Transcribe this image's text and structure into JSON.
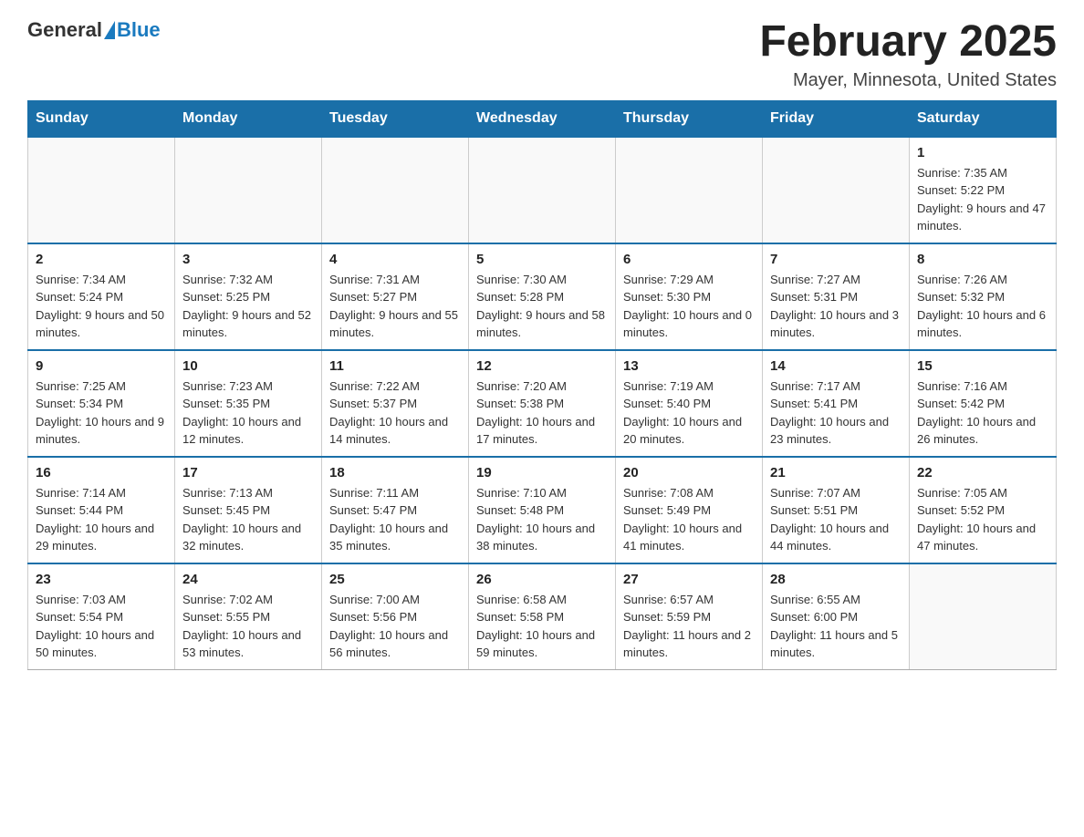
{
  "header": {
    "logo_general": "General",
    "logo_blue": "Blue",
    "month_title": "February 2025",
    "location": "Mayer, Minnesota, United States"
  },
  "days_of_week": [
    "Sunday",
    "Monday",
    "Tuesday",
    "Wednesday",
    "Thursday",
    "Friday",
    "Saturday"
  ],
  "weeks": [
    [
      {
        "day": "",
        "info": ""
      },
      {
        "day": "",
        "info": ""
      },
      {
        "day": "",
        "info": ""
      },
      {
        "day": "",
        "info": ""
      },
      {
        "day": "",
        "info": ""
      },
      {
        "day": "",
        "info": ""
      },
      {
        "day": "1",
        "info": "Sunrise: 7:35 AM\nSunset: 5:22 PM\nDaylight: 9 hours and 47 minutes."
      }
    ],
    [
      {
        "day": "2",
        "info": "Sunrise: 7:34 AM\nSunset: 5:24 PM\nDaylight: 9 hours and 50 minutes."
      },
      {
        "day": "3",
        "info": "Sunrise: 7:32 AM\nSunset: 5:25 PM\nDaylight: 9 hours and 52 minutes."
      },
      {
        "day": "4",
        "info": "Sunrise: 7:31 AM\nSunset: 5:27 PM\nDaylight: 9 hours and 55 minutes."
      },
      {
        "day": "5",
        "info": "Sunrise: 7:30 AM\nSunset: 5:28 PM\nDaylight: 9 hours and 58 minutes."
      },
      {
        "day": "6",
        "info": "Sunrise: 7:29 AM\nSunset: 5:30 PM\nDaylight: 10 hours and 0 minutes."
      },
      {
        "day": "7",
        "info": "Sunrise: 7:27 AM\nSunset: 5:31 PM\nDaylight: 10 hours and 3 minutes."
      },
      {
        "day": "8",
        "info": "Sunrise: 7:26 AM\nSunset: 5:32 PM\nDaylight: 10 hours and 6 minutes."
      }
    ],
    [
      {
        "day": "9",
        "info": "Sunrise: 7:25 AM\nSunset: 5:34 PM\nDaylight: 10 hours and 9 minutes."
      },
      {
        "day": "10",
        "info": "Sunrise: 7:23 AM\nSunset: 5:35 PM\nDaylight: 10 hours and 12 minutes."
      },
      {
        "day": "11",
        "info": "Sunrise: 7:22 AM\nSunset: 5:37 PM\nDaylight: 10 hours and 14 minutes."
      },
      {
        "day": "12",
        "info": "Sunrise: 7:20 AM\nSunset: 5:38 PM\nDaylight: 10 hours and 17 minutes."
      },
      {
        "day": "13",
        "info": "Sunrise: 7:19 AM\nSunset: 5:40 PM\nDaylight: 10 hours and 20 minutes."
      },
      {
        "day": "14",
        "info": "Sunrise: 7:17 AM\nSunset: 5:41 PM\nDaylight: 10 hours and 23 minutes."
      },
      {
        "day": "15",
        "info": "Sunrise: 7:16 AM\nSunset: 5:42 PM\nDaylight: 10 hours and 26 minutes."
      }
    ],
    [
      {
        "day": "16",
        "info": "Sunrise: 7:14 AM\nSunset: 5:44 PM\nDaylight: 10 hours and 29 minutes."
      },
      {
        "day": "17",
        "info": "Sunrise: 7:13 AM\nSunset: 5:45 PM\nDaylight: 10 hours and 32 minutes."
      },
      {
        "day": "18",
        "info": "Sunrise: 7:11 AM\nSunset: 5:47 PM\nDaylight: 10 hours and 35 minutes."
      },
      {
        "day": "19",
        "info": "Sunrise: 7:10 AM\nSunset: 5:48 PM\nDaylight: 10 hours and 38 minutes."
      },
      {
        "day": "20",
        "info": "Sunrise: 7:08 AM\nSunset: 5:49 PM\nDaylight: 10 hours and 41 minutes."
      },
      {
        "day": "21",
        "info": "Sunrise: 7:07 AM\nSunset: 5:51 PM\nDaylight: 10 hours and 44 minutes."
      },
      {
        "day": "22",
        "info": "Sunrise: 7:05 AM\nSunset: 5:52 PM\nDaylight: 10 hours and 47 minutes."
      }
    ],
    [
      {
        "day": "23",
        "info": "Sunrise: 7:03 AM\nSunset: 5:54 PM\nDaylight: 10 hours and 50 minutes."
      },
      {
        "day": "24",
        "info": "Sunrise: 7:02 AM\nSunset: 5:55 PM\nDaylight: 10 hours and 53 minutes."
      },
      {
        "day": "25",
        "info": "Sunrise: 7:00 AM\nSunset: 5:56 PM\nDaylight: 10 hours and 56 minutes."
      },
      {
        "day": "26",
        "info": "Sunrise: 6:58 AM\nSunset: 5:58 PM\nDaylight: 10 hours and 59 minutes."
      },
      {
        "day": "27",
        "info": "Sunrise: 6:57 AM\nSunset: 5:59 PM\nDaylight: 11 hours and 2 minutes."
      },
      {
        "day": "28",
        "info": "Sunrise: 6:55 AM\nSunset: 6:00 PM\nDaylight: 11 hours and 5 minutes."
      },
      {
        "day": "",
        "info": ""
      }
    ]
  ]
}
